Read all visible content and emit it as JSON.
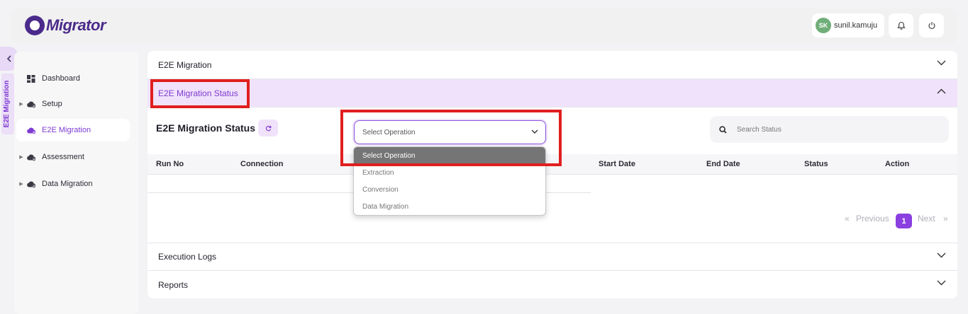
{
  "header": {
    "logo_text": "Migrator",
    "user_initials": "SK",
    "user_name": "sunil.kamuju"
  },
  "side_tab": {
    "label": "E2E Migration"
  },
  "sidebar": {
    "items": [
      {
        "label": "Dashboard",
        "icon": "dashboard-icon",
        "has_caret": false,
        "active": false
      },
      {
        "label": "Setup",
        "icon": "cloud-gear-icon",
        "has_caret": true,
        "active": false
      },
      {
        "label": "E2E Migration",
        "icon": "cloud-gear-icon",
        "has_caret": false,
        "active": true
      },
      {
        "label": "Assessment",
        "icon": "cloud-gear-icon",
        "has_caret": true,
        "active": false
      },
      {
        "label": "Data Migration",
        "icon": "cloud-gear-icon",
        "has_caret": true,
        "active": false
      }
    ]
  },
  "main": {
    "accordions": [
      {
        "label": "E2E Migration",
        "open": false
      },
      {
        "label": "E2E Migration Status",
        "open": true
      },
      {
        "label": "Execution Logs",
        "open": false
      },
      {
        "label": "Reports",
        "open": false
      }
    ],
    "status": {
      "title": "E2E Migration Status",
      "select_value": "Select Operation",
      "select_options": [
        "Select Operation",
        "Extraction",
        "Conversion",
        "Data Migration"
      ],
      "search_placeholder": "Search Status",
      "columns": [
        "Run No",
        "Connection",
        "Start Date",
        "End Date",
        "Status",
        "Action"
      ],
      "pagination": {
        "previous": "Previous",
        "next": "Next",
        "current_page": "1",
        "first_glyph": "«",
        "last_glyph": "»"
      }
    }
  },
  "colors": {
    "accent": "#7e3bd1",
    "accent_light": "#f1e2fb",
    "highlight_red": "#e01f1f",
    "avatar_green": "#6fae78"
  }
}
